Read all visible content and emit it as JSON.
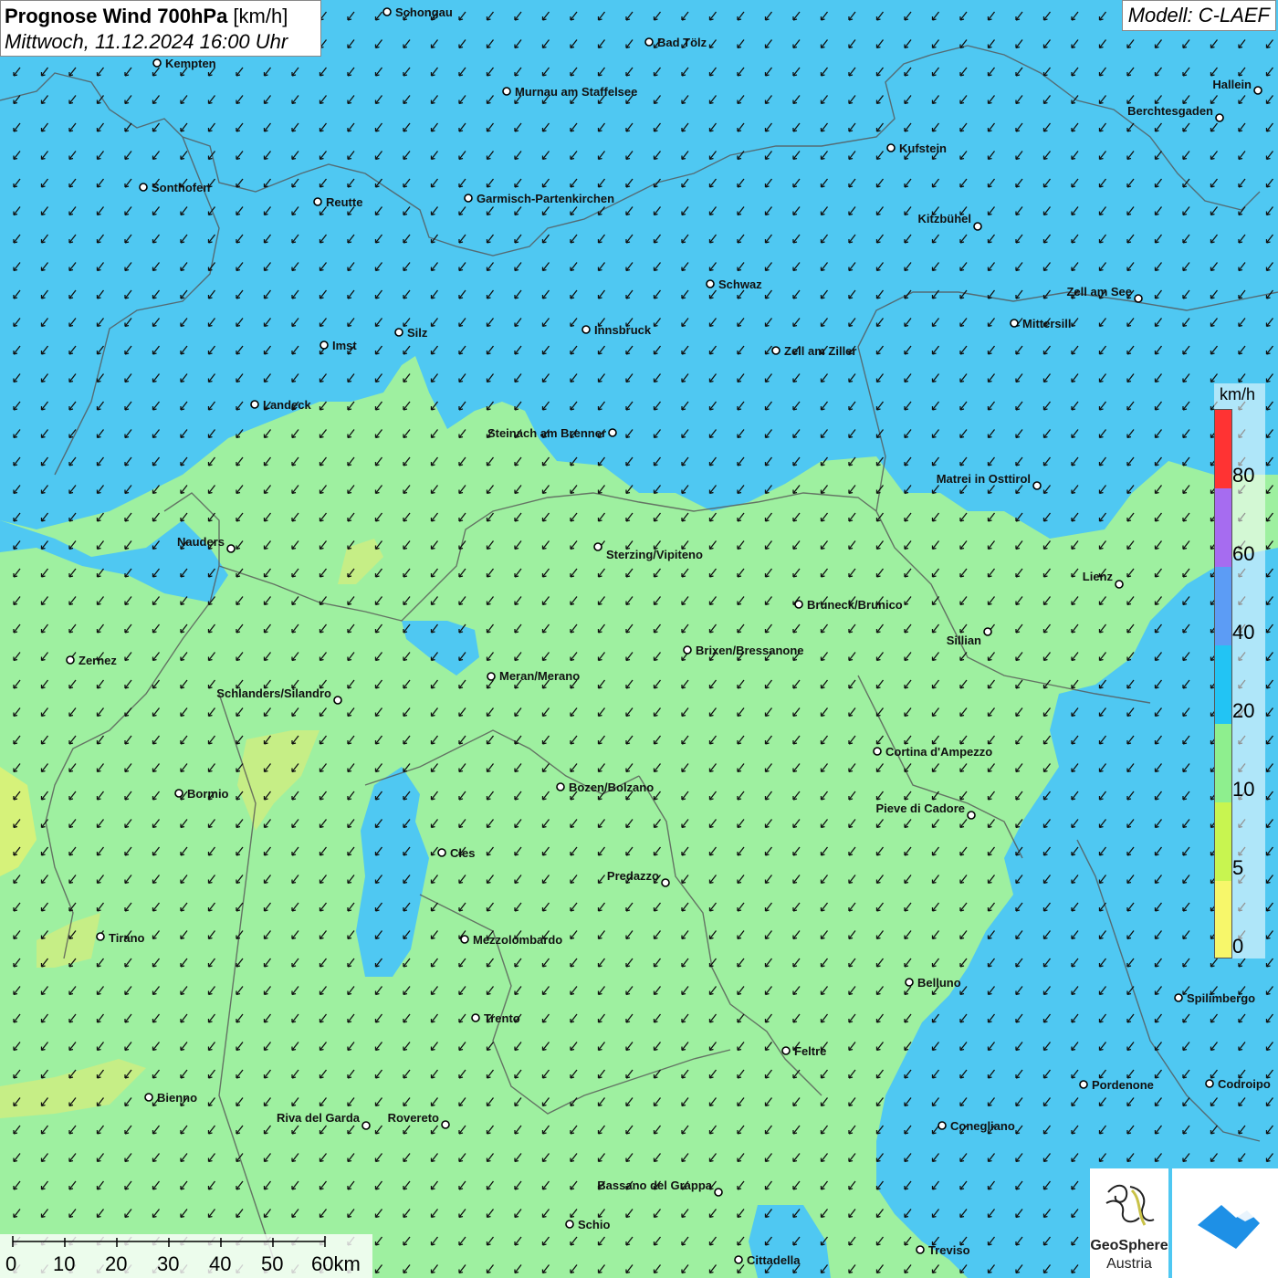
{
  "header": {
    "title_bold": "Prognose Wind 700hPa",
    "title_unit": " [km/h]",
    "datetime": "Mittwoch, 11.12.2024 16:00 Uhr",
    "model": "Modell: C-LAEF"
  },
  "legend": {
    "unit": "km/h",
    "labels": [
      "80",
      "60",
      "40",
      "20",
      "10",
      "5",
      "0"
    ],
    "colors": [
      "#ff3333",
      "#a66cf0",
      "#5c9cf5",
      "#22c4f4",
      "#8eef8e",
      "#c8f550",
      "#f7f76a"
    ]
  },
  "scale_bar": {
    "labels": [
      "0",
      "10",
      "20",
      "30",
      "40",
      "50",
      "60km"
    ]
  },
  "logo": {
    "name_line1": "GeoSphere",
    "name_line2": "Austria"
  },
  "map_colors": {
    "low_wind": "#9ef0a0",
    "mid_wind": "#4cc7f0",
    "high_wind": "#3aa8f0",
    "calm": "#e8f56a"
  },
  "wind_arrow_direction": "from north-east (pointing south-west)",
  "cities": [
    {
      "name": "Schongau"
    },
    {
      "name": "Kempten"
    },
    {
      "name": "Bad Tölz"
    },
    {
      "name": "Murnau am Staffelsee"
    },
    {
      "name": "Hallein"
    },
    {
      "name": "Berchtesgaden"
    },
    {
      "name": "Kufstein"
    },
    {
      "name": "Sonthofen"
    },
    {
      "name": "Reutte"
    },
    {
      "name": "Garmisch-Partenkirchen"
    },
    {
      "name": "Kitzbühel"
    },
    {
      "name": "Schwaz"
    },
    {
      "name": "Zell am See"
    },
    {
      "name": "Mittersill"
    },
    {
      "name": "Innsbruck"
    },
    {
      "name": "Imst"
    },
    {
      "name": "Silz"
    },
    {
      "name": "Zell am Ziller"
    },
    {
      "name": "Landeck"
    },
    {
      "name": "Steinach am Brenner"
    },
    {
      "name": "Matrei in Osttirol"
    },
    {
      "name": "Nauders"
    },
    {
      "name": "Sterzing/Vipiteno"
    },
    {
      "name": "Lienz"
    },
    {
      "name": "Bruneck/Brunico"
    },
    {
      "name": "Sillian"
    },
    {
      "name": "Zernez"
    },
    {
      "name": "Brixen/Bressanone"
    },
    {
      "name": "Meran/Merano"
    },
    {
      "name": "Schlanders/Silandro"
    },
    {
      "name": "Cortina d'Ampezzo"
    },
    {
      "name": "Bozen/Bolzano"
    },
    {
      "name": "Bormio"
    },
    {
      "name": "Pieve di Cadore"
    },
    {
      "name": "Cles"
    },
    {
      "name": "Predazzo"
    },
    {
      "name": "Tirano"
    },
    {
      "name": "Mezzolombardo"
    },
    {
      "name": "Belluno"
    },
    {
      "name": "Spilimbergo"
    },
    {
      "name": "Trento"
    },
    {
      "name": "Feltre"
    },
    {
      "name": "Pordenone"
    },
    {
      "name": "Codroipo"
    },
    {
      "name": "Bienno"
    },
    {
      "name": "Riva del Garda"
    },
    {
      "name": "Rovereto"
    },
    {
      "name": "Conegliano"
    },
    {
      "name": "Bassano del Grappa"
    },
    {
      "name": "Schio"
    },
    {
      "name": "Treviso"
    },
    {
      "name": "Cittadella"
    }
  ]
}
